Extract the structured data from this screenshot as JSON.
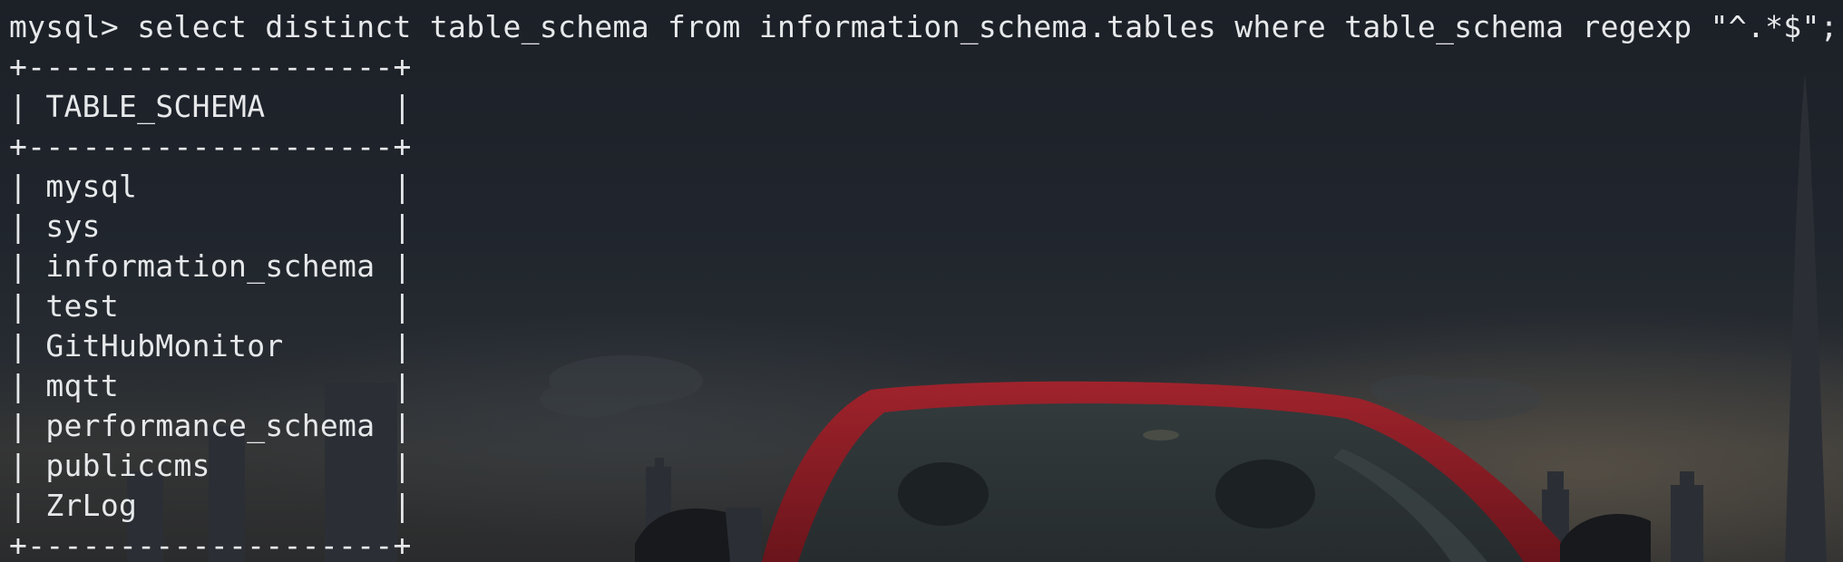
{
  "terminal": {
    "prompt": "mysql> ",
    "command": "select distinct table_schema from information_schema.tables where table_schema regexp \"^.*$\";",
    "table": {
      "border_line": "+--------------------+",
      "header": "TABLE_SCHEMA",
      "rows": [
        "mysql",
        "sys",
        "information_schema",
        "test",
        "GitHubMonitor",
        "mqtt",
        "performance_schema",
        "publiccms",
        "ZrLog"
      ]
    }
  },
  "wallpaper": {
    "subject": "red car in front of a dusk city skyline",
    "colors": {
      "sky": "#1f242b",
      "horizon_glow": "#6e6252",
      "car_body": "#8e1d25",
      "car_glass": "#2e3536"
    }
  }
}
